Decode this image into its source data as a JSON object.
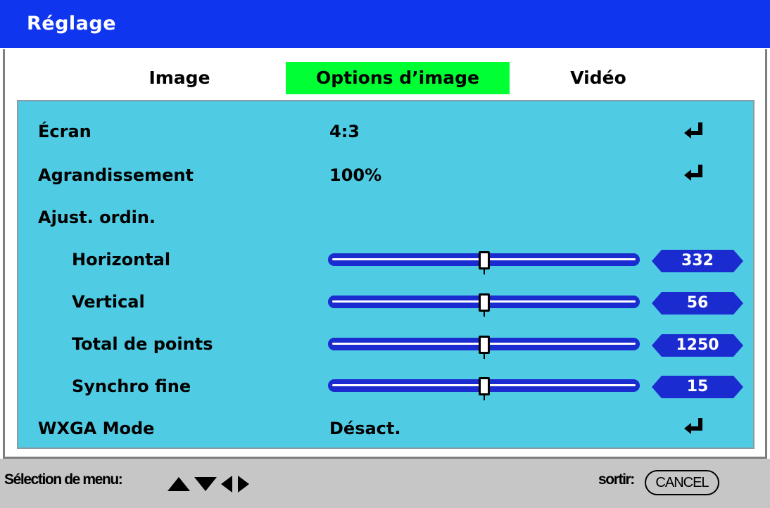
{
  "window": {
    "title": "Réglage"
  },
  "tabs": [
    {
      "label": "Image",
      "active": false
    },
    {
      "label": "Options d’image",
      "active": true
    },
    {
      "label": "Vidéo",
      "active": false
    }
  ],
  "rows": {
    "ecran": {
      "label": "Écran",
      "value": "4:3",
      "icon": "enter-icon"
    },
    "agrandissement": {
      "label": "Agrandissement",
      "value": "100%",
      "icon": "enter-icon"
    },
    "ajust": {
      "label": "Ajust. ordin."
    },
    "horizontal": {
      "label": "Horizontal",
      "value": "332",
      "level": 0.5
    },
    "vertical": {
      "label": "Vertical",
      "value": "56",
      "level": 0.5
    },
    "total": {
      "label": "Total de points",
      "value": "1250",
      "level": 0.5
    },
    "synchro": {
      "label": "Synchro fine",
      "value": "15",
      "level": 0.5
    },
    "wxga": {
      "label": "WXGA Mode",
      "value": "Désact.",
      "icon": "enter-icon"
    }
  },
  "footer": {
    "hint": "Sélection de menu:",
    "exit_label": "sortir:",
    "cancel": "CANCEL"
  },
  "colors": {
    "titlebar": "#0f35ee",
    "panel": "#4fcbe3",
    "active_tab": "#00ff33",
    "slider": "#1a2bd0"
  }
}
